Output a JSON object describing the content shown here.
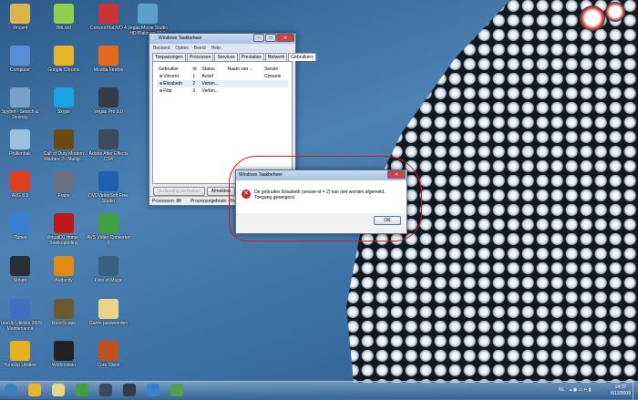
{
  "desktop_icons": [
    {
      "label": "Vincent",
      "color": "#d9b54a"
    },
    {
      "label": "BitLord",
      "color": "#8fd14f"
    },
    {
      "label": "ConvertXtoDVD 4",
      "color": "#c33"
    },
    {
      "label": "Computer",
      "color": "#5a8fd8"
    },
    {
      "label": "Google Chrome",
      "color": "#e8b52a"
    },
    {
      "label": "Mozilla Firefox",
      "color": "#e66a1e"
    },
    {
      "label": "Spybot - Search & Destroy",
      "color": "#7aa0c8"
    },
    {
      "label": "Skype",
      "color": "#1aa3e0"
    },
    {
      "label": "Vegas Pro 8.0",
      "color": "#333a48"
    },
    {
      "label": "Prullenbak",
      "color": "#9bc0e0"
    },
    {
      "label": "Call of Duty Modern Warfare 2 - Multip...",
      "color": "#6a4a10"
    },
    {
      "label": "Adobe After Effects CS4",
      "color": "#3c4a60"
    },
    {
      "label": "AVG 8.5",
      "color": "#e04020"
    },
    {
      "label": "Fraps",
      "color": "#6a7080"
    },
    {
      "label": "DVDVideoSoft Free Studio",
      "color": "#2060b0"
    },
    {
      "label": "iTunes",
      "color": "#3a80d0"
    },
    {
      "label": "VirtualDJ Home - Snelkoppeling",
      "color": "#c01818"
    },
    {
      "label": "AVS Video Converter 6",
      "color": "#40a040"
    },
    {
      "label": "Steam",
      "color": "#2a2e36"
    },
    {
      "label": "Audacity",
      "color": "#e08a10"
    },
    {
      "label": "Fists of Magic",
      "color": "#3a6080"
    },
    {
      "label": "TuneUp Utilities 2009 Maintenance",
      "color": "#4070c0"
    },
    {
      "label": "RuneScape",
      "color": "#6a5a30"
    },
    {
      "label": "Game paswoorden",
      "color": "#e8d48a"
    },
    {
      "label": "TuneUp Utilities",
      "color": "#e8b020"
    },
    {
      "label": "Wolfenstein",
      "color": "#222"
    },
    {
      "label": "Core Client",
      "color": "#c05020"
    }
  ],
  "extra_icon": {
    "label": "Vegas Movie Studio HD Platinum 10.0",
    "color": "#5aa0c8"
  },
  "taskmgr": {
    "title": "Windows Taakbeheer",
    "menu": [
      "Bestand",
      "Opties",
      "Beeld",
      "Help"
    ],
    "tabs": [
      "Toepassingen",
      "Processen",
      "Services",
      "Prestaties",
      "Netwerk",
      "Gebruikers"
    ],
    "active_tab": "Gebruikers",
    "columns": [
      "Gebruiker",
      "Id",
      "Status",
      "Naam van ...",
      "Sessie"
    ],
    "rows": [
      [
        "Vincent",
        "1",
        "Actief",
        "",
        "Console"
      ],
      [
        "Elisabeth",
        "2",
        "Verbin...",
        "",
        ""
      ],
      [
        "Filip",
        "3",
        "Verbin...",
        "",
        ""
      ]
    ],
    "btn_disconnect": "Verbinding verbreken",
    "btn_logoff": "Afmelden",
    "status_processes": "Processen: 88",
    "status_cpu": "Processorgebruik: 0%"
  },
  "dialog": {
    "title": "Windows Taakbeheer",
    "message": "De gebruiker Elisabeth (sessie-id = 2) kan niet worden afgemeld.",
    "message2": "Toegang geweigerd.",
    "ok": "OK"
  },
  "tray": {
    "lang": "NL",
    "time": "14:37",
    "date": "6/11/2009"
  },
  "taskbar_apps": [
    {
      "name": "start",
      "color": "#3a80c0"
    },
    {
      "name": "chrome",
      "color": "#e8b52a"
    },
    {
      "name": "explorer",
      "color": "#e8d48a"
    },
    {
      "name": "messenger",
      "color": "#40a040"
    },
    {
      "name": "after-effects",
      "color": "#3c4a60"
    },
    {
      "name": "vegas",
      "color": "#333a48"
    },
    {
      "name": "itunes",
      "color": "#3a80d0"
    },
    {
      "name": "taskmgr",
      "color": "#50a050"
    }
  ]
}
